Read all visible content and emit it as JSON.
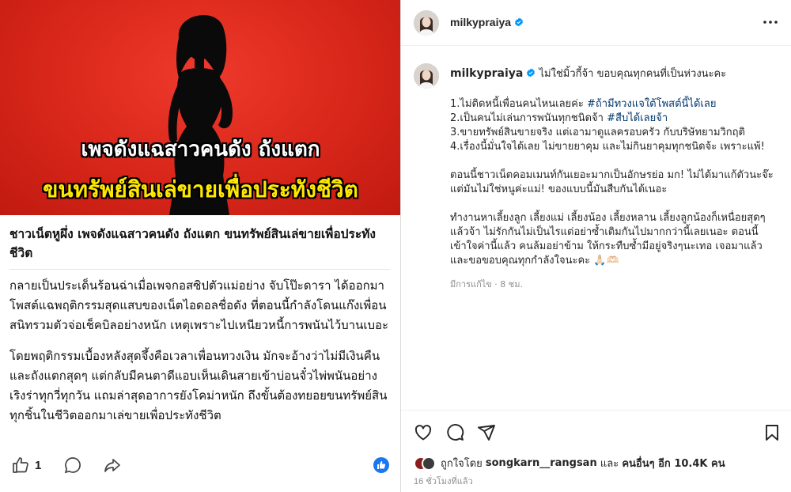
{
  "facebook_post": {
    "image": {
      "headline_line1": "เพจดังแฉสาวคนดัง ถังแตก",
      "headline_line2": "ขนทรัพย์สินเล่ขายเพื่อประทังชีวิต",
      "background_color": "#d8261a",
      "headline_line2_color": "#ffe800"
    },
    "title": "ชาวเน็ตหูผึ่ง เพจดังแฉสาวคนดัง ถังแตก ขนทรัพย์สินเล่ขายเพื่อประทังชีวิต",
    "paragraphs": [
      "กลายเป็นประเด็นร้อนฉ่าเมื่อเพจกอสซิปตัวแม่อย่าง จับโป๊ะดารา ได้ออกมาโพสต์แฉพฤติกรรมสุดแสบของเน็ตไอดอลชื่อดัง ที่ตอนนี้กำลังโดนแก๊งเพื่อนสนิทรวมตัวจ่อเช็คบิลอย่างหนัก เหตุเพราะไปเหนียวหนี้การพนันไว้บานเบอะ",
      "โดยพฤติกรรมเบื้องหลังสุดจึ้งคือเวลาเพื่อนทวงเงิน มักจะอ้างว่าไม่มีเงินคืนและถังแตกสุดๆ แต่กลับมีคนตาดีแอบเห็นเดินสายเข้าบ่อนจั๋วไพ่พนันอย่างเริงร่าทุกวี่ทุกวัน แถมล่าสุดอาการยังโคม่าหนัก ถึงขั้นต้องทยอยขนทรัพย์สินทุกชิ้นในชีวิตออกมาเล่ขายเพื่อประทังชีวิต"
    ],
    "actions": {
      "like_count": "1",
      "like_icon": "thumbs-up-icon",
      "comment_icon": "comment-icon",
      "share_icon": "share-icon",
      "reaction_icon": "like-reaction-icon"
    }
  },
  "instagram_post": {
    "header": {
      "username": "milkypraiya",
      "verified_icon": "verified-badge-icon",
      "more_icon": "more-options-icon"
    },
    "caption": {
      "username": "milkypraiya",
      "first_line": "ไม่ใช่มิ้วกี้จ้า ขอบคุณทุกคนที่เป็นห่วงนะคะ",
      "list": [
        {
          "text": "1.ไม่ติดหนี้เพื่อนคนไหนเลยค่ะ ",
          "hashtag": "#ถ้ามีทวงแจใต้โพสต์นี้ได้เลย"
        },
        {
          "text": "2.เป็นคนไม่เล่นการพนันทุกชนิดจ้า ",
          "hashtag": "#สืบได้เลยจ้า"
        },
        {
          "text": "3.ขายทรัพย์สินขายจริง แต่เอามาดูแลครอบครัว กับบริษัทยามวิกฤติ",
          "hashtag": ""
        },
        {
          "text": "4.เรื่องนี้มั่นใจได้เลย ไม่ขายยาคุม และไม่กินยาคุมทุกชนิดจ้ะ เพราะแพ้!",
          "hashtag": ""
        }
      ],
      "paragraph2": "ตอนนี้ชาวเน็ตคอมเมนท์กันเยอะมากเป็นอักษรย่อ มก! ไม่ได้มาแก้ตัวนะจ๊ะ แต่มันไม่ใช่หนูค่ะแม่! ของแบบนี้มันสืบกันได้เนอะ",
      "paragraph3": "ทำงานหาเลี้ยงลูก เลี้ยงแม่ เลี้ยงน้อง เลี้ยงหลาน เลี้ยงลูกน้องก็เหนื่อยสุดๆแล้วจ้า ไม่รักกันไม่เป็นไรแต่อย่าซ้ำเติมกันไปมากกว่านี้เลยเนอะ ตอนนี้เข้าใจค่านี้แล้ว คนล้มอย่าข้าม ให้กระทืบซ้ำมีอยู่จริงๆนะเทอ เจอมาแล้ว และขอขอบคุณทุกกำลังใจนะคะ 🙏🏻🫶🏻",
      "edited_label": "มีการแก้ไข · 8 ชม."
    },
    "bottom": {
      "heart_icon": "heart-icon",
      "comment_icon": "comment-icon",
      "share_icon": "paper-plane-icon",
      "save_icon": "bookmark-icon",
      "liked_by_prefix": "ถูกใจโดย",
      "liked_by_user": "songkarn__rangsan",
      "liked_by_middle": "และ",
      "liked_by_rest": "คนอื่นๆ อีก 10.4K คน",
      "time_ago": "16 ชั่วโมงที่แล้ว"
    }
  }
}
